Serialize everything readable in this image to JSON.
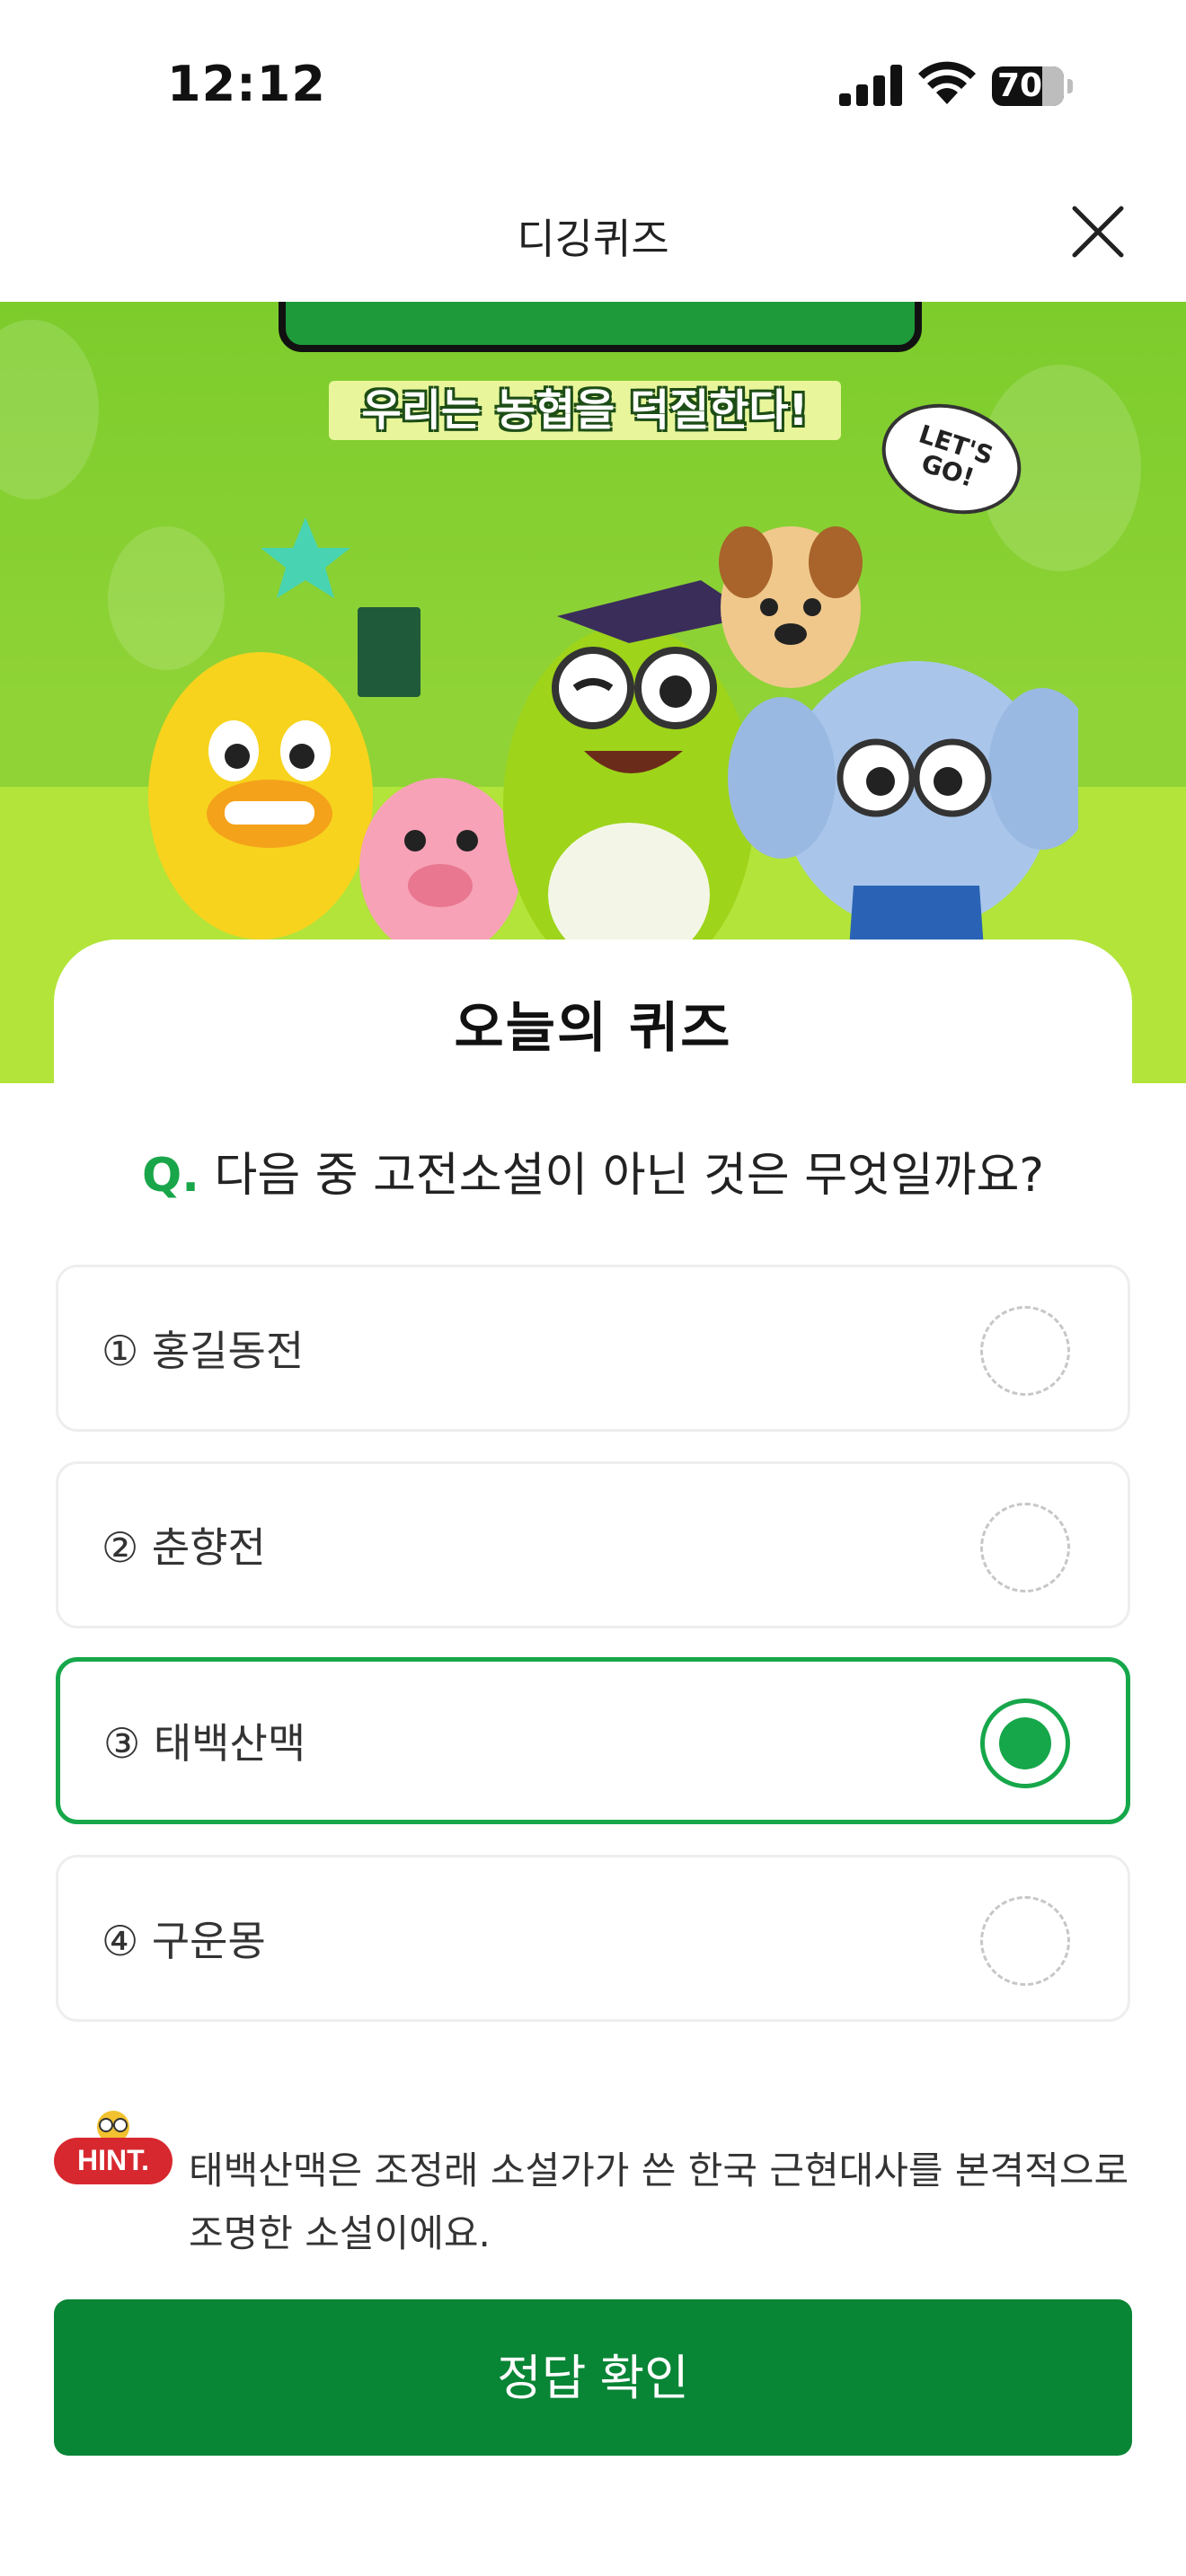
{
  "status_bar": {
    "time": "12:12",
    "battery": "70"
  },
  "header": {
    "title": "디깅퀴즈"
  },
  "banner": {
    "slogan": "우리는 농협을 덕질한다!",
    "speech": "LET'S GO!"
  },
  "quiz": {
    "title": "오늘의 퀴즈",
    "question_prefix": "Q.",
    "question": "다음 중 고전소설이 아닌 것은 무엇일까요?",
    "options": [
      {
        "label": "① 홍길동전",
        "selected": false
      },
      {
        "label": "② 춘향전",
        "selected": false
      },
      {
        "label": "③ 태백산맥",
        "selected": true
      },
      {
        "label": "④ 구운몽",
        "selected": false
      }
    ],
    "hint_badge": "HINT.",
    "hint_text": "태백산맥은 조정래 소설가가 쓴 한국 근현대사를 본격적으로 조명한 소설이에요.",
    "submit_label": "정답 확인"
  },
  "colors": {
    "accent": "#16a74a",
    "button": "#088535",
    "hint": "#d7282f"
  }
}
